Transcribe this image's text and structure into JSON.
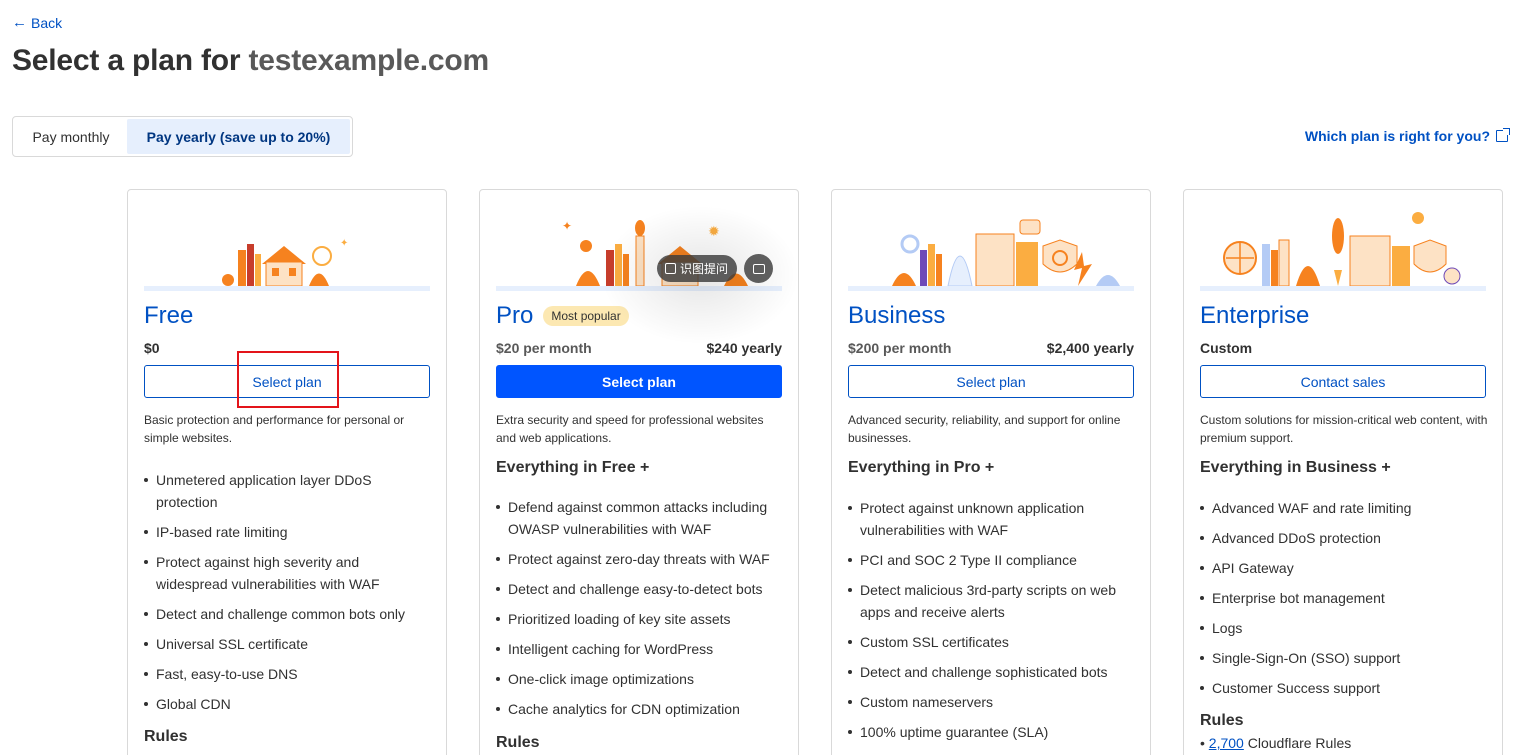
{
  "nav": {
    "back_label": "Back"
  },
  "header": {
    "title_prefix": "Select a plan for ",
    "domain": "testexample.com"
  },
  "billing_toggle": {
    "monthly_label": "Pay monthly",
    "yearly_label": "Pay yearly (save up to 20%)",
    "selected": "yearly"
  },
  "help_link": {
    "label": "Which plan is right for you?"
  },
  "overlay": {
    "ocr_label": "识图提问"
  },
  "plans": [
    {
      "name": "Free",
      "price": "$0",
      "button": "Select plan",
      "description": "Basic protection and performance for personal or simple websites.",
      "features": [
        "Unmetered application layer DDoS protection",
        "IP-based rate limiting",
        "Protect against high severity and widespread vulnerabilities with WAF",
        "Detect and challenge common bots only",
        "Universal SSL certificate",
        "Fast, easy-to-use DNS",
        "Global CDN"
      ],
      "rules_heading": "Rules"
    },
    {
      "name": "Pro",
      "badge": "Most popular",
      "price": "$20 per month",
      "price_yearly": "$240 yearly",
      "button": "Select plan",
      "description": "Extra security and speed for professional websites and web applications.",
      "includes": "Everything in Free +",
      "features": [
        "Defend against common attacks including OWASP vulnerabilities with WAF",
        "Protect against zero-day threats with WAF",
        "Detect and challenge easy-to-detect bots",
        "Prioritized loading of key site assets",
        "Intelligent caching for WordPress",
        "One-click image optimizations",
        "Cache analytics for CDN optimization"
      ],
      "rules_heading": "Rules"
    },
    {
      "name": "Business",
      "price": "$200 per month",
      "price_yearly": "$2,400 yearly",
      "button": "Select plan",
      "description": "Advanced security, reliability, and support for online businesses.",
      "includes": "Everything in Pro +",
      "features": [
        "Protect against unknown application vulnerabilities with WAF",
        "PCI and SOC 2 Type II compliance",
        "Detect malicious 3rd-party scripts on web apps and receive alerts",
        "Custom SSL certificates",
        "Detect and challenge sophisticated bots",
        "Custom nameservers",
        "100% uptime guarantee (SLA)"
      ]
    },
    {
      "name": "Enterprise",
      "price": "Custom",
      "button": "Contact sales",
      "description": "Custom solutions for mission-critical web content, with premium support.",
      "includes": "Everything in Business +",
      "features": [
        "Advanced WAF and rate limiting",
        "Advanced DDoS protection",
        "API Gateway",
        "Enterprise bot management",
        "Logs",
        "Single-Sign-On (SSO) support",
        "Customer Success support"
      ],
      "rules_heading": "Rules",
      "rules_count": "2,700",
      "rules_label": " Cloudflare Rules"
    }
  ],
  "colors": {
    "accent": "#0051c3",
    "primary_button": "#0055ff",
    "badge": "#fce8b2",
    "illustration_orange": "#f6821f"
  }
}
